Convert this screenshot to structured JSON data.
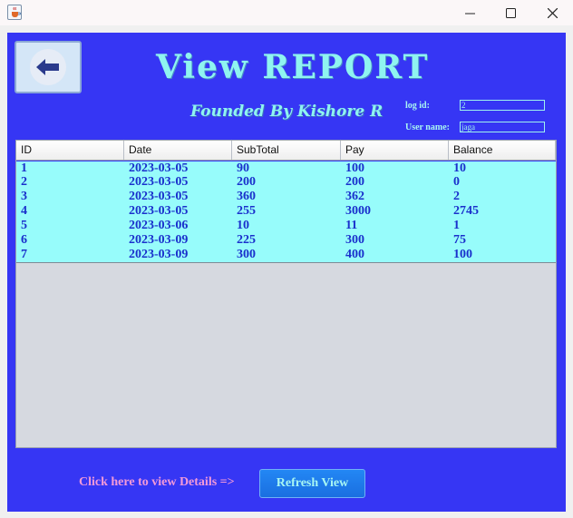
{
  "titlebar": {
    "icons": {
      "app": "java-cup-icon",
      "minimize": "minimize-icon",
      "maximize": "maximize-icon",
      "close": "close-icon"
    }
  },
  "header": {
    "back_icon": "arrow-left-icon",
    "title": "View REPORT",
    "founder": "Founded By Kishore R"
  },
  "login": {
    "log_id_label": "log id:",
    "log_id_value": "2",
    "user_name_label": "User name:",
    "user_name_value": "jaga"
  },
  "table": {
    "columns": [
      "ID",
      "Date",
      "SubTotal",
      "Pay",
      "Balance"
    ],
    "rows": [
      [
        "1",
        "2023-03-05",
        "90",
        "100",
        "10"
      ],
      [
        "2",
        "2023-03-05",
        "200",
        "200",
        "0"
      ],
      [
        "3",
        "2023-03-05",
        "360",
        "362",
        "2"
      ],
      [
        "4",
        "2023-03-05",
        "255",
        "3000",
        "2745"
      ],
      [
        "5",
        "2023-03-06",
        "10",
        "11",
        "1"
      ],
      [
        "6",
        "2023-03-09",
        "225",
        "300",
        "75"
      ],
      [
        "7",
        "2023-03-09",
        "300",
        "400",
        "100"
      ]
    ]
  },
  "footer": {
    "hint": "Click here to view Details =>",
    "refresh_label": "Refresh View"
  },
  "colors": {
    "background": "#3636f4",
    "accent": "#8ff4f0",
    "table_rows": "#97fcfb",
    "row_text": "#1a30cc",
    "hint_text": "#f39ad8",
    "button": "#1a78ea"
  }
}
